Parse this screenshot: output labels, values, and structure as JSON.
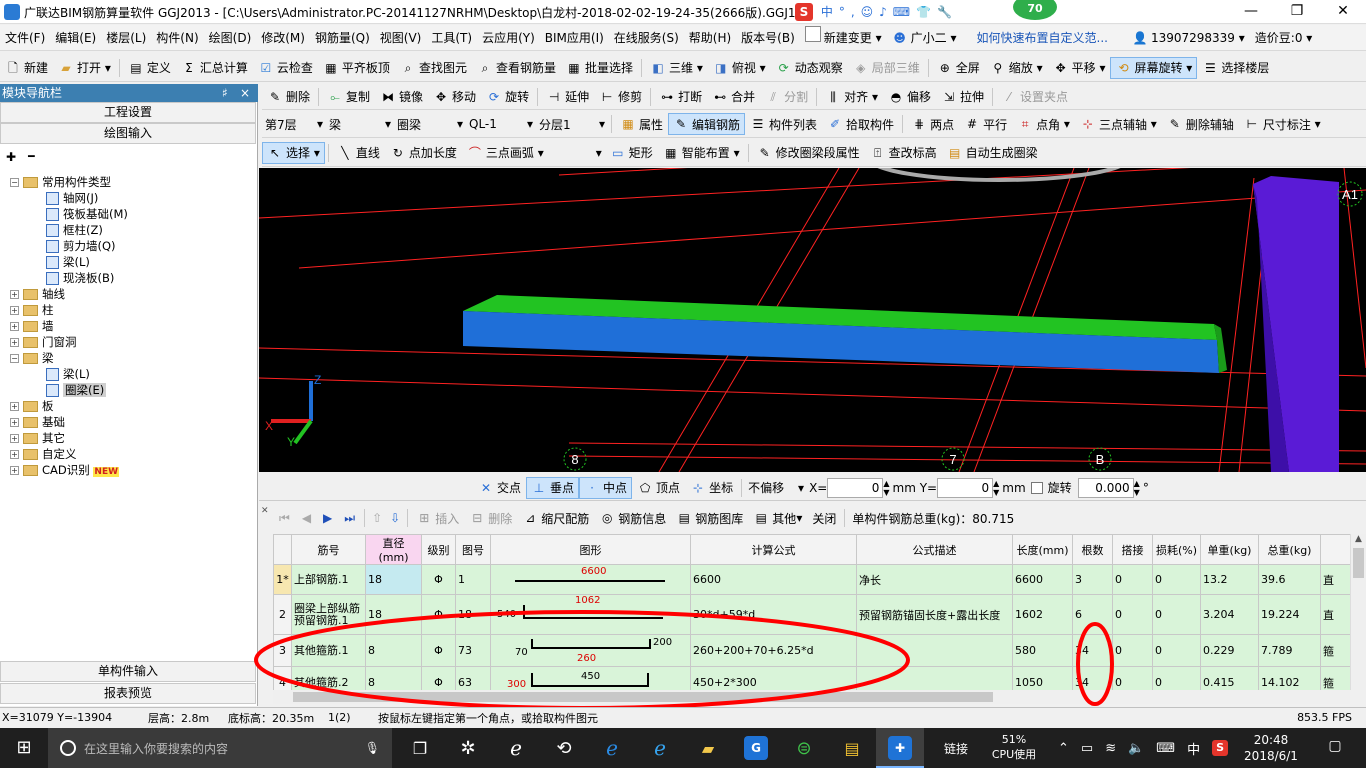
{
  "window": {
    "title": "广联达BIM钢筋算量软件 GGJ2013 - [C:\\Users\\Administrator.PC-20141127NRHM\\Desktop\\白龙村-2018-02-02-19-24-35(2666版).GGJ12]",
    "badge": "70",
    "minimize": "—",
    "maximize": "❐",
    "close": "✕"
  },
  "menu": [
    "文件(F)",
    "编辑(E)",
    "楼层(L)",
    "构件(N)",
    "绘图(D)",
    "修改(M)",
    "钢筋量(Q)",
    "视图(V)",
    "工具(T)",
    "云应用(Y)",
    "BIM应用(I)",
    "在线服务(S)",
    "帮助(H)",
    "版本号(B)"
  ],
  "menu_right": {
    "new_change": "新建变更",
    "assistant": "广小二",
    "help_link": "如何快速布置自定义范...",
    "phone": "13907298339",
    "cost_bean": "造价豆:0"
  },
  "toolbar1": [
    "新建",
    "打开",
    "定义",
    "汇总计算",
    "云检查",
    "平齐板顶",
    "查找图元",
    "查看钢筋量",
    "批量选择",
    "三维",
    "俯视",
    "动态观察",
    "局部三维",
    "全屏",
    "缩放",
    "平移",
    "屏幕旋转",
    "选择楼层"
  ],
  "toolbar2": [
    "删除",
    "复制",
    "镜像",
    "移动",
    "旋转",
    "延伸",
    "修剪",
    "打断",
    "合并",
    "分割",
    "对齐",
    "偏移",
    "拉伸",
    "设置夹点"
  ],
  "toolbar3": {
    "floor": "第7层",
    "category": "梁",
    "type": "圈梁",
    "component": "QL-1",
    "layer": "分层1",
    "buttons": [
      "属性",
      "编辑钢筋",
      "构件列表",
      "拾取构件",
      "两点",
      "平行",
      "点角",
      "三点辅轴",
      "删除辅轴",
      "尺寸标注"
    ]
  },
  "toolbar4": [
    "选择",
    "直线",
    "点加长度",
    "三点画弧",
    "矩形",
    "智能布置",
    "修改圈梁段属性",
    "查改标高",
    "自动生成圈梁"
  ],
  "left_panel": {
    "title": "模块导航栏",
    "pin": "♯",
    "close": "×",
    "btn_project": "工程设置",
    "btn_draw": "绘图输入",
    "expand_icon": "✚",
    "collapse_icon": "━",
    "tree": [
      {
        "label": "常用构件类型",
        "level": 0,
        "expander": "−",
        "kind": "folder"
      },
      {
        "label": "轴网(J)",
        "level": 1,
        "kind": "leaf"
      },
      {
        "label": "筏板基础(M)",
        "level": 1,
        "kind": "leaf"
      },
      {
        "label": "框柱(Z)",
        "level": 1,
        "kind": "leaf"
      },
      {
        "label": "剪力墙(Q)",
        "level": 1,
        "kind": "leaf"
      },
      {
        "label": "梁(L)",
        "level": 1,
        "kind": "leaf"
      },
      {
        "label": "现浇板(B)",
        "level": 1,
        "kind": "leaf"
      },
      {
        "label": "轴线",
        "level": 0,
        "expander": "+",
        "kind": "folder"
      },
      {
        "label": "柱",
        "level": 0,
        "expander": "+",
        "kind": "folder"
      },
      {
        "label": "墙",
        "level": 0,
        "expander": "+",
        "kind": "folder"
      },
      {
        "label": "门窗洞",
        "level": 0,
        "expander": "+",
        "kind": "folder"
      },
      {
        "label": "梁",
        "level": 0,
        "expander": "−",
        "kind": "folder"
      },
      {
        "label": "梁(L)",
        "level": 1,
        "kind": "leaf"
      },
      {
        "label": "圈梁(E)",
        "level": 1,
        "kind": "leaf",
        "selected": true
      },
      {
        "label": "板",
        "level": 0,
        "expander": "+",
        "kind": "folder"
      },
      {
        "label": "基础",
        "level": 0,
        "expander": "+",
        "kind": "folder"
      },
      {
        "label": "其它",
        "level": 0,
        "expander": "+",
        "kind": "folder"
      },
      {
        "label": "自定义",
        "level": 0,
        "expander": "+",
        "kind": "folder"
      },
      {
        "label": "CAD识别",
        "level": 0,
        "expander": "+",
        "kind": "folder",
        "badge": "NEW"
      }
    ],
    "btn_single": "单构件输入",
    "btn_report": "报表预览"
  },
  "viewport": {
    "axis_labels": [
      "A1",
      "8",
      "7",
      "B"
    ],
    "axis_z": "Z",
    "axis_x": "X",
    "axis_y": "Y"
  },
  "snapbar": {
    "items": [
      "交点",
      "垂点",
      "中点",
      "顶点",
      "坐标"
    ],
    "offset_mode": "不偏移",
    "x_label": "X=",
    "x_value": "0",
    "y_label": "mm Y=",
    "y_value": "0",
    "mm": "mm",
    "rotate_label": "旋转",
    "rotate_value": "0.000",
    "degree": "°"
  },
  "rebar_toolbar": {
    "items": [
      "插入",
      "删除",
      "缩尺配筋",
      "钢筋信息",
      "钢筋图库",
      "其他",
      "关闭"
    ],
    "total_label": "单构件钢筋总重(kg)：80.715"
  },
  "rebar_table": {
    "columns": [
      "筋号",
      "直径(mm)",
      "级别",
      "图号",
      "图形",
      "计算公式",
      "公式描述",
      "长度(mm)",
      "根数",
      "搭接",
      "损耗(%)",
      "单重(kg)",
      "总重(kg)",
      ""
    ],
    "rows": [
      {
        "idx": "1*",
        "name": "上部钢筋.1",
        "dia": "18",
        "grade": "Φ",
        "fig": "1",
        "shape": {
          "top": "6600"
        },
        "formula": "6600",
        "desc": "净长",
        "length": "6600",
        "count": "3",
        "lap": "0",
        "loss": "0",
        "unit": "13.2",
        "total": "39.6",
        "extra": "直"
      },
      {
        "idx": "2",
        "name": "圈梁上部纵筋预留钢筋.1",
        "dia": "18",
        "grade": "Φ",
        "fig": "18",
        "shape": {
          "left": "540",
          "top": "1062"
        },
        "formula": "30*d+59*d",
        "desc": "预留钢筋锚固长度+露出长度",
        "length": "1602",
        "count": "6",
        "lap": "0",
        "loss": "0",
        "unit": "3.204",
        "total": "19.224",
        "extra": "直"
      },
      {
        "idx": "3",
        "name": "其他箍筋.1",
        "dia": "8",
        "grade": "Φ",
        "fig": "73",
        "shape": {
          "left": "70",
          "mid": "260",
          "right": "200"
        },
        "formula": "260+200+70+6.25*d",
        "desc": "",
        "length": "580",
        "count": "34",
        "lap": "0",
        "loss": "0",
        "unit": "0.229",
        "total": "7.789",
        "extra": "箍"
      },
      {
        "idx": "4",
        "name": "其他箍筋.2",
        "dia": "8",
        "grade": "Φ",
        "fig": "63",
        "shape": {
          "left": "300",
          "top": "450"
        },
        "formula": "450+2*300",
        "desc": "",
        "length": "1050",
        "count": "34",
        "lap": "0",
        "loss": "0",
        "unit": "0.415",
        "total": "14.102",
        "extra": "箍"
      }
    ]
  },
  "statusbar": {
    "coords": "X=31079 Y=-13904",
    "floor_height": "层高：2.8m",
    "base_height": "底标高：20.35m",
    "count": "1(2)",
    "hint": "按鼠标左键指定第一个角点，或拾取构件图元",
    "fps": "853.5 FPS"
  },
  "taskbar": {
    "search_placeholder": "在这里输入你要搜索的内容",
    "link": "链接",
    "cpu_pct": "51%",
    "cpu_label": "CPU使用",
    "ime": "中",
    "time": "20:48",
    "date": "2018/6/1"
  },
  "colors": {
    "title_accent": "#3c7fb1",
    "viewport_bg": "#000000",
    "grid_line": "#ff2020",
    "beam_top": "#22c322",
    "beam_side": "#1f6fd8",
    "column": "#5a1bd6",
    "table_bg": "#d9f4d9",
    "annotation": "#ff0000"
  }
}
